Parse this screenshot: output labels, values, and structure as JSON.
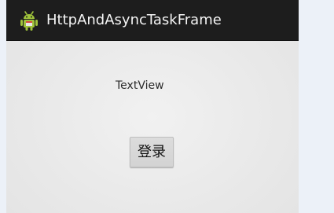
{
  "action_bar": {
    "title": "HttpAndAsyncTaskFrame",
    "icon": "android-icon",
    "background_color": "#1d1d1d",
    "accent_color": "#9fc33b"
  },
  "main": {
    "text_view": "TextView",
    "login_button_label": "登录"
  }
}
